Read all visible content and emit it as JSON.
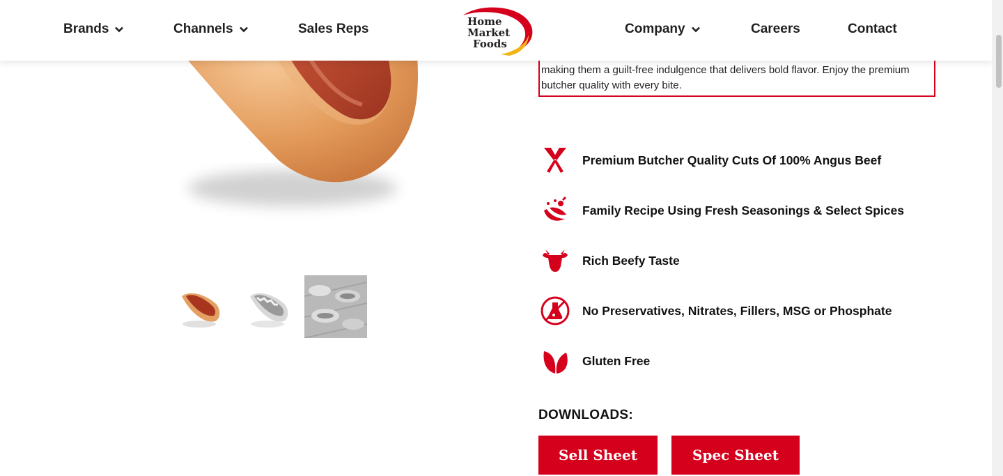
{
  "nav": {
    "brands": "Brands",
    "channels": "Channels",
    "sales_reps": "Sales Reps",
    "company": "Company",
    "careers": "Careers",
    "contact": "Contact"
  },
  "logo": {
    "line1": "Home",
    "line2": "Market",
    "line3": "Foods"
  },
  "description": "making them a guilt-free indulgence that delivers bold flavor. Enjoy the premium butcher quality with every bite.",
  "features": [
    {
      "icon": "cleaver-icon",
      "label": "Premium Butcher Quality Cuts Of 100% Angus Beef"
    },
    {
      "icon": "spices-icon",
      "label": "Family Recipe Using Fresh Seasonings & Select Spices"
    },
    {
      "icon": "cow-icon",
      "label": "Rich Beefy Taste"
    },
    {
      "icon": "no-chemicals-icon",
      "label": "No Preservatives, Nitrates, Fillers, MSG or Phosphate"
    },
    {
      "icon": "leaf-icon",
      "label": "Gluten Free"
    }
  ],
  "downloads": {
    "title": "DOWNLOADS:",
    "sell_sheet": "Sell Sheet",
    "spec_sheet": "Spec Sheet"
  },
  "colors": {
    "brand_red": "#d5001c",
    "logo_yellow": "#f2b417"
  }
}
